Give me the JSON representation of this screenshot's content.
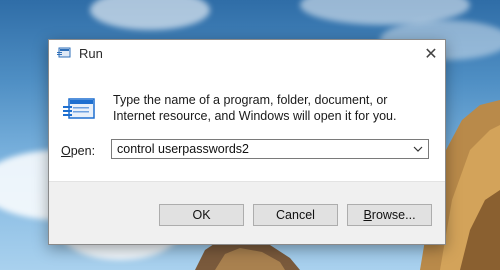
{
  "window": {
    "title": "Run",
    "title_icon": "run-icon",
    "close_icon": "close-icon"
  },
  "content": {
    "icon": "run-icon",
    "description": "Type the name of a program, folder, document, or Internet resource, and Windows will open it for you.",
    "open_label": "Open:",
    "open_accelerator": "O",
    "open_rest": "pen:",
    "open_value": "control userpasswords2",
    "dropdown_icon": "chevron-down-icon"
  },
  "buttons": {
    "ok": "OK",
    "cancel": "Cancel",
    "browse": "Browse...",
    "browse_accelerator": "B",
    "browse_rest": "rowse..."
  },
  "colors": {
    "dialog_bg": "#ffffff",
    "footer_bg": "#f0f0f0",
    "button_bg": "#e1e1e1",
    "icon_blue": "#1e6fd0"
  }
}
